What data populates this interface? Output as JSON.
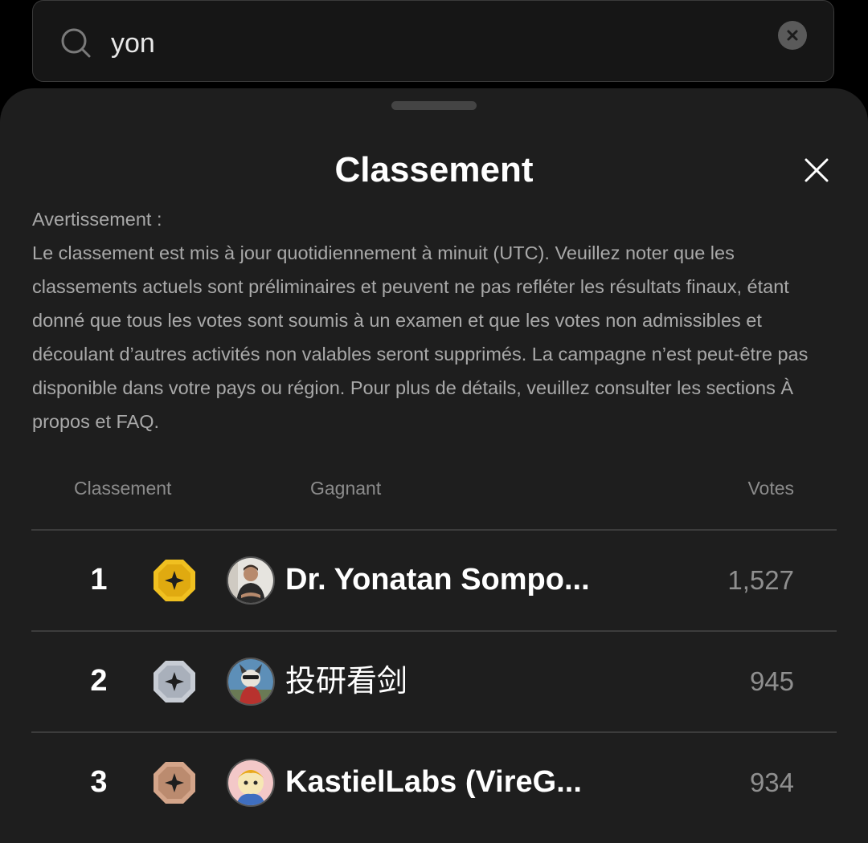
{
  "search": {
    "value": "yon"
  },
  "sheet": {
    "title": "Classement",
    "notice_heading": "Avertissement :",
    "notice_body": "Le classement est mis à jour quotidiennement à minuit (UTC). Veuillez noter que les classements actuels sont préliminaires et peuvent ne pas refléter les résultats finaux, étant donné que tous les votes sont soumis à un examen et que les votes non admissibles et découlant d’autres activités non valables seront supprimés. La campagne n’est peut-être pas disponible dans votre pays ou région. Pour plus de détails, veuillez consulter les sections À propos et FAQ."
  },
  "table": {
    "headers": {
      "rank": "Classement",
      "winner": "Gagnant",
      "votes": "Votes"
    },
    "rows": [
      {
        "rank": "1",
        "medal": "gold-medal-icon",
        "name": "Dr. Yonatan Sompo...",
        "votes": "1,527"
      },
      {
        "rank": "2",
        "medal": "silver-medal-icon",
        "name": "投研看剑",
        "votes": "945"
      },
      {
        "rank": "3",
        "medal": "bronze-medal-icon",
        "name": "KastielLabs (VireG...",
        "votes": "934"
      }
    ]
  },
  "colors": {
    "gold": "#f0c020",
    "silver": "#c7ccd4",
    "bronze": "#d4a58a",
    "sheet_bg": "#1e1e1e",
    "page_bg": "#000000"
  }
}
